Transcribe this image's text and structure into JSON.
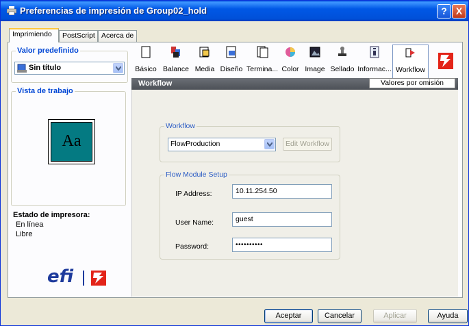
{
  "window": {
    "title": "Preferencias de impresión de Group02_hold",
    "help_glyph": "?",
    "close_glyph": "X"
  },
  "tabs": [
    {
      "label": "Imprimiendo"
    },
    {
      "label": "PostScript"
    },
    {
      "label": "Acerca de"
    }
  ],
  "preset": {
    "legend": "Valor predefinido",
    "selected": "Sin título"
  },
  "preview": {
    "legend": "Vista de trabajo",
    "sample_text": "Aa"
  },
  "printer_status": {
    "title": "Estado de impresora:",
    "lines": [
      "En línea",
      "Libre"
    ]
  },
  "toolbar": [
    {
      "label": "Básico",
      "icon": "page-icon"
    },
    {
      "label": "Balance",
      "icon": "balance-icon"
    },
    {
      "label": "Media",
      "icon": "media-icon"
    },
    {
      "label": "Diseño",
      "icon": "layout-icon"
    },
    {
      "label": "Termina...",
      "icon": "finishing-icon"
    },
    {
      "label": "Color",
      "icon": "color-icon"
    },
    {
      "label": "Image",
      "icon": "image-icon"
    },
    {
      "label": "Sellado",
      "icon": "stamp-icon"
    },
    {
      "label": "Informac...",
      "icon": "info-icon"
    },
    {
      "label": "Workflow",
      "icon": "workflow-icon"
    }
  ],
  "section": {
    "title": "Workflow",
    "defaults_button": "Valores por omisión"
  },
  "workflow": {
    "legend": "Workflow",
    "selected": "FlowProduction",
    "edit_button": "Edit Workflow"
  },
  "flow_module": {
    "legend": "Flow Module Setup",
    "ip_label": "IP Address:",
    "ip_value": "10.11.254.50",
    "user_label": "User Name:",
    "user_value": "guest",
    "password_label": "Password:",
    "password_value": "••••••••••"
  },
  "branding": {
    "efi_logo": "efi",
    "fiery_logo": "fiery"
  },
  "footer": {
    "ok": "Aceptar",
    "cancel": "Cancelar",
    "apply": "Aplicar",
    "help": "Ayuda"
  },
  "colors": {
    "titlebar": "#0054e3",
    "accent": "#0046d5",
    "preview_fill": "#047a82"
  }
}
